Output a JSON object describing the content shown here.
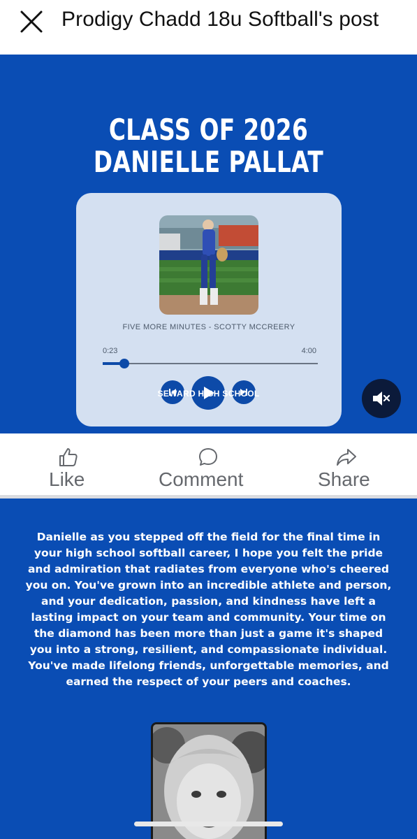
{
  "header": {
    "title": "Prodigy Chadd 18u Softball's post",
    "close_icon": "close-x-icon"
  },
  "graphic": {
    "title_line1": "CLASS OF 2026",
    "title_line2": "DANIELLE PALLAT",
    "school": "SEWARD HIGH SCHOOL",
    "background_color": "#0a4db4"
  },
  "player": {
    "song": "FIVE MORE MINUTES - SCOTTY MCCREERY",
    "current_time": "0:23",
    "total_time": "4:00",
    "progress_fraction": 0.1,
    "buttons": [
      "previous-icon",
      "play-icon",
      "next-icon"
    ],
    "accent_color": "#0d4aa8"
  },
  "video_controls": {
    "mute_icon": "speaker-muted-icon"
  },
  "actions": {
    "like_label": "Like",
    "comment_label": "Comment",
    "share_label": "Share"
  },
  "post": {
    "message": "Danielle as you stepped off the field for the final time in your high school softball career, I hope you felt the pride and admiration that radiates from everyone who's cheered you on. You've grown into an incredible athlete and person, and your dedication, passion, and kindness have left a lasting impact on your team and community. Your time on the diamond has been more than just a game it's shaped you into a strong, resilient, and compassionate individual. You've made lifelong friends, unforgettable memories, and earned the respect of your peers and coaches."
  }
}
